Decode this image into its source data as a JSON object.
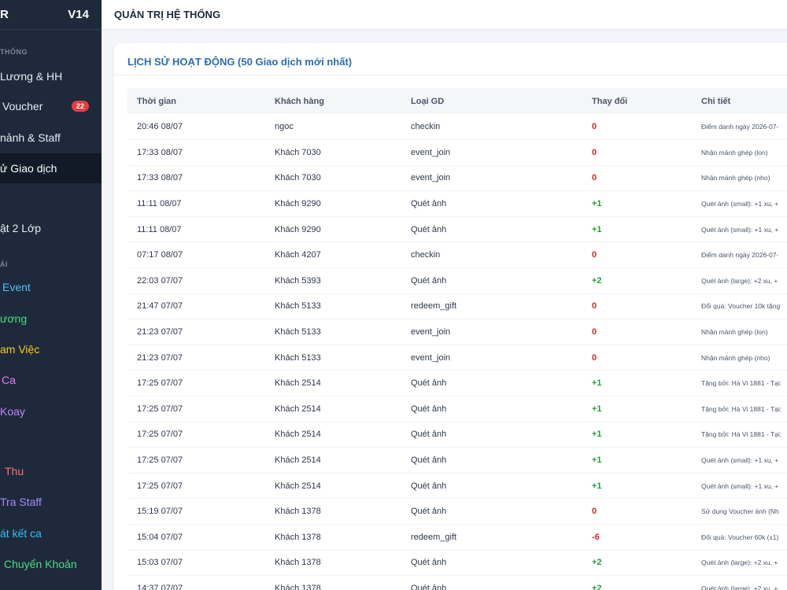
{
  "sidebar": {
    "brand": "R",
    "version": "V14",
    "section1": "THỐNG",
    "section2": "ÁI",
    "items": [
      {
        "label": "Lương & HH",
        "color": "#e6ebf2"
      },
      {
        "label": "Voucher",
        "color": "#e6ebf2",
        "badge": "22"
      },
      {
        "label": "nảnh & Staff",
        "color": "#e6ebf2"
      },
      {
        "label": "ử Giao dịch",
        "color": "#ffffff",
        "active": true
      },
      {
        "label": "ật 2 Lớp",
        "color": "#e6ebf2"
      },
      {
        "label": "Event",
        "color": "#4fc3f7"
      },
      {
        "label": "ương",
        "color": "#4ade80"
      },
      {
        "label": "am Việc",
        "color": "#facc15"
      },
      {
        "label": "Ca",
        "color": "#e879f9"
      },
      {
        "label": "Koay",
        "color": "#c084fc"
      },
      {
        "label": "Thu",
        "color": "#f87171"
      },
      {
        "label": "Tra Staff",
        "color": "#a78bfa"
      },
      {
        "label": "át kết ca",
        "color": "#38bdf8"
      },
      {
        "label": "Chuyển Khoản",
        "color": "#4ade80"
      }
    ]
  },
  "header": {
    "title": "QUẢN TRỊ HỆ THỐNG"
  },
  "panel": {
    "title": "LỊCH SỬ HOẠT ĐỘNG (50 Giao dịch mới nhất)",
    "columns": [
      "Thời gian",
      "Khách hàng",
      "Loại GD",
      "Thay đổi",
      "Chi tiết"
    ],
    "rows": [
      [
        "20:46 08/07",
        "ngoc",
        "checkin",
        "0",
        "Điểm danh ngày 2026-07-"
      ],
      [
        "17:33 08/07",
        "Khách 7030",
        "event_join",
        "0",
        "Nhận mảnh ghép (lon)"
      ],
      [
        "17:33 08/07",
        "Khách 7030",
        "event_join",
        "0",
        "Nhận mảnh ghép (nho)"
      ],
      [
        "11:11 08/07",
        "Khách 9290",
        "Quét ảnh",
        "+1",
        "Quét ảnh (small): +1 xu, +"
      ],
      [
        "11:11 08/07",
        "Khách 9290",
        "Quét ảnh",
        "+1",
        "Quét ảnh (small): +1 xu, +"
      ],
      [
        "07:17 08/07",
        "Khách 4207",
        "checkin",
        "0",
        "Điểm danh ngày 2026-07-"
      ],
      [
        "22:03 07/07",
        "Khách 5393",
        "Quét ảnh",
        "+2",
        "Quét ảnh (large): +2 xu, +"
      ],
      [
        "21:47 07/07",
        "Khách 5133",
        "redeem_gift",
        "0",
        "Đổi quà: Voucher 10k tặng"
      ],
      [
        "21:23 07/07",
        "Khách 5133",
        "event_join",
        "0",
        "Nhận mảnh ghép (lon)"
      ],
      [
        "21:23 07/07",
        "Khách 5133",
        "event_join",
        "0",
        "Nhận mảnh ghép (nho)"
      ],
      [
        "17:25 07/07",
        "Khách 2514",
        "Quét ảnh",
        "+1",
        "Tặng bởi: Hà Vi 1881 - Tại:"
      ],
      [
        "17:25 07/07",
        "Khách 2514",
        "Quét ảnh",
        "+1",
        "Tặng bởi: Hà Vi 1881 - Tại:"
      ],
      [
        "17:25 07/07",
        "Khách 2514",
        "Quét ảnh",
        "+1",
        "Tặng bởi: Hà Vi 1881 - Tại:"
      ],
      [
        "17:25 07/07",
        "Khách 2514",
        "Quét ảnh",
        "+1",
        "Quét ảnh (small): +1 xu, +"
      ],
      [
        "17:25 07/07",
        "Khách 2514",
        "Quét ảnh",
        "+1",
        "Quét ảnh (small): +1 xu, +"
      ],
      [
        "15:19 07/07",
        "Khách 1378",
        "Quét ảnh",
        "0",
        "Sử dụng Voucher ảnh (Nh"
      ],
      [
        "15:04 07/07",
        "Khách 1378",
        "redeem_gift",
        "-6",
        "Đổi quà: Voucher 60k (x1)"
      ],
      [
        "15:03 07/07",
        "Khách 1378",
        "Quét ảnh",
        "+2",
        "Quét ảnh (large): +2 xu, +"
      ],
      [
        "14:37 07/07",
        "Khách 1378",
        "Quét ảnh",
        "+2",
        "Quét ảnh (large): +2 xu, +"
      ]
    ]
  },
  "colors": {
    "positive": "#1e9e3a",
    "negative": "#e02424",
    "accent": "#2b6cb0"
  }
}
